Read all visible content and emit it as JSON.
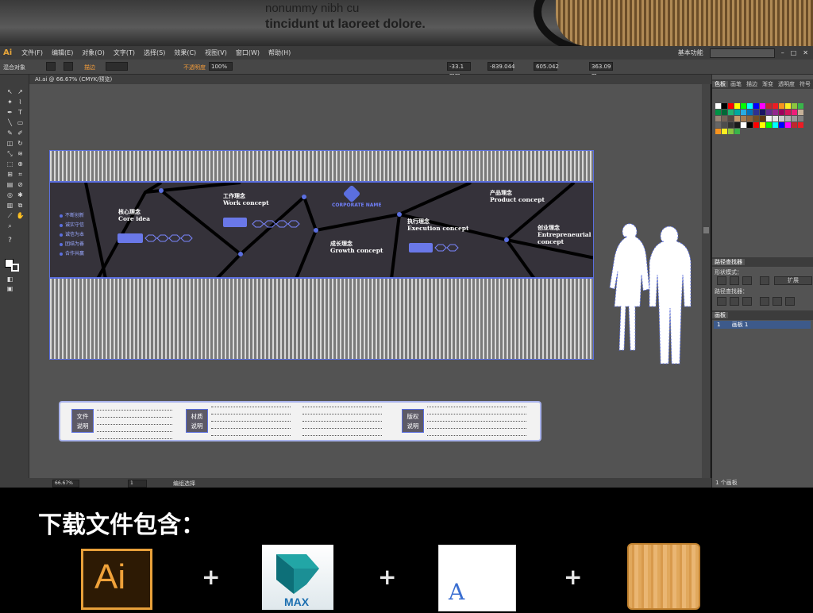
{
  "banner": {
    "line1": "nonummy nibh cu",
    "line2": "tincidunt ut laoreet dolore."
  },
  "app": {
    "logo": "Ai",
    "workspace": "基本功能"
  },
  "menu": [
    "文件(F)",
    "编辑(E)",
    "对象(O)",
    "文字(T)",
    "选择(S)",
    "效果(C)",
    "视图(V)",
    "窗口(W)",
    "帮助(H)"
  ],
  "control": {
    "selection": "混合对象",
    "stroke_label": "描边",
    "opacity_label": "不透明度",
    "opacity_value": "100%",
    "x_value": "-33.1 mm",
    "y_value": "-839.044",
    "w_value": "605.042",
    "h_value": "363.09 m"
  },
  "document": {
    "tab": "AI.ai @ 66.67% (CMYK/预览)"
  },
  "panels": {
    "top_tabs": [
      "色板",
      "画笔",
      "描边",
      "渐变",
      "透明度",
      "符号"
    ],
    "pathfinder_tabs": [
      "路径查找器"
    ],
    "shape_modes": "形状模式：",
    "expand": "扩展",
    "pathfinders": "路径查找器：",
    "artboard_tabs": [
      "画板"
    ],
    "artboard_row_index": "1",
    "artboard_row_name": "画板 1",
    "artboard_count": "1 个画板"
  },
  "status": {
    "zoom": "66.67%",
    "page": "1",
    "mode": "编组选择"
  },
  "artboard": {
    "bullets": [
      "不断创新",
      "诚实守信",
      "诚信为本",
      "团结为善",
      "合作共赢"
    ],
    "core": {
      "cn": "核心理念",
      "en": "Core idea"
    },
    "work": {
      "cn": "工作理念",
      "en": "Work concept"
    },
    "corp": "CORPORATE NAME",
    "growth": {
      "cn": "成长理念",
      "en": "Growth concept"
    },
    "execution": {
      "cn": "执行理念",
      "en": "Execution concept"
    },
    "product": {
      "cn": "产品理念",
      "en": "Product concept"
    },
    "entrepreneurial": {
      "cn": "创业理念",
      "en1": "Entrepreneurial",
      "en2": "concept"
    }
  },
  "info": {
    "file": {
      "l1": "文件",
      "l2": "说明"
    },
    "material": {
      "l1": "材质",
      "l2": "说明"
    },
    "copyright": {
      "l1": "版权",
      "l2": "说明"
    }
  },
  "download": {
    "title": "下载文件包含：",
    "ai_label": "Ai",
    "max_label": "MAX",
    "font_label": "A",
    "plus": "+"
  },
  "colors": {
    "accent": "#5b6fe0",
    "panel_dark": "#35323a",
    "ai_orange": "#e8a03a"
  }
}
